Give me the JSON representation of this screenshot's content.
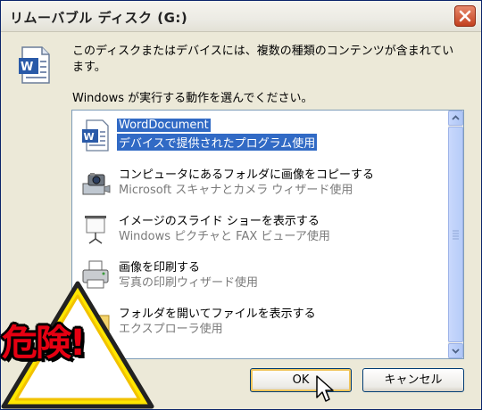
{
  "window": {
    "title": "リムーバブル ディスク (G:)"
  },
  "message": "このディスクまたはデバイスには、複数の種類のコンテンツが含まれています。",
  "prompt": "Windows が実行する動作を選んでください。",
  "actions": [
    {
      "title": "WordDocument",
      "subtitle": "デバイスで提供されたプログラム使用",
      "icon": "word-document-icon",
      "selected": true
    },
    {
      "title": "コンピュータにあるフォルダに画像をコピーする",
      "subtitle": "Microsoft スキャナとカメラ ウィザード使用",
      "icon": "camera-icon"
    },
    {
      "title": "イメージのスライド ショーを表示する",
      "subtitle": "Windows ピクチャと FAX ビューア使用",
      "icon": "projector-screen-icon"
    },
    {
      "title": "画像を印刷する",
      "subtitle": "写真の印刷ウィザード使用",
      "icon": "printer-icon"
    },
    {
      "title": "フォルダを開いてファイルを表示する",
      "subtitle": "エクスプローラ使用",
      "icon": "folder-icon"
    }
  ],
  "buttons": {
    "ok": "OK",
    "cancel": "キャンセル"
  },
  "warning": {
    "text": "危険!",
    "color": "#e60012"
  },
  "colors": {
    "selection": "#316ac5",
    "title_close": "#c2401f"
  }
}
